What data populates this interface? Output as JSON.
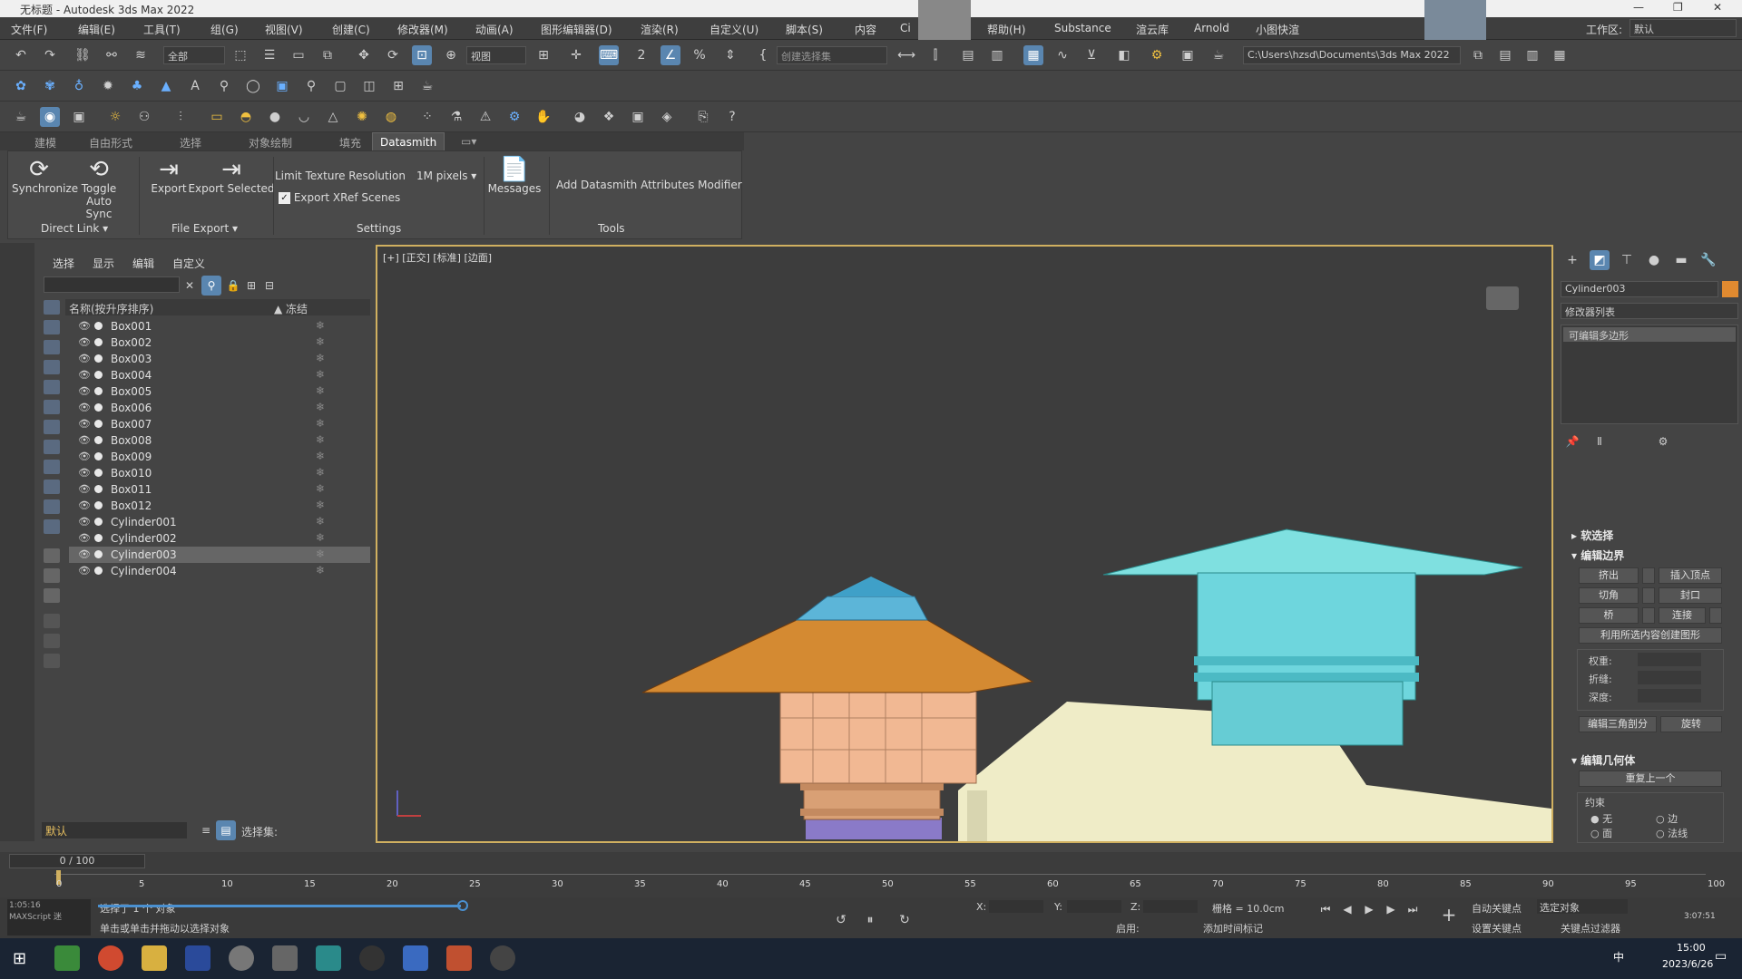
{
  "window": {
    "title": "无标题 - Autodesk 3ds Max 2022"
  },
  "menu": [
    "文件(F)",
    "编辑(E)",
    "工具(T)",
    "组(G)",
    "视图(V)",
    "创建(C)",
    "修改器(M)",
    "动画(A)",
    "图形编辑器(D)",
    "渲染(R)",
    "自定义(U)",
    "脚本(S)",
    "内容",
    "Ci",
    "帮助(H)",
    "Substance",
    "渲云库",
    "Arnold",
    "小图快渲"
  ],
  "workspace": {
    "label": "工作区:",
    "value": "默认"
  },
  "toolbar": {
    "filter_value": "全部",
    "view_value": "视图",
    "selection_set_placeholder": "创建选择集",
    "path_value": "C:\\Users\\hzsd\\Documents\\3ds Max 2022"
  },
  "ribbon_tabs": [
    "建模",
    "自由形式",
    "选择",
    "对象绘制",
    "填充",
    "Datasmith"
  ],
  "ribbon": {
    "synchronize": "Synchronize",
    "toggle": "Toggle",
    "auto_sync": "Auto Sync",
    "export": "Export",
    "export_selected": "Export Selected",
    "limit_texture": "Limit Texture Resolution",
    "pixels": "1M pixels",
    "export_xref": "Export XRef Scenes",
    "messages": "Messages",
    "add_attributes": "Add Datasmith Attributes Modifier",
    "group_direct_link": "Direct Link",
    "group_file_export": "File Export",
    "group_settings": "Settings",
    "group_tools": "Tools"
  },
  "explorer": {
    "tabs": [
      "选择",
      "显示",
      "编辑",
      "自定义"
    ],
    "col_name": "名称(按升序排序)",
    "col_freeze": "▲ 冻结",
    "items": [
      {
        "name": "Box001"
      },
      {
        "name": "Box002"
      },
      {
        "name": "Box003"
      },
      {
        "name": "Box004"
      },
      {
        "name": "Box005"
      },
      {
        "name": "Box006"
      },
      {
        "name": "Box007"
      },
      {
        "name": "Box008"
      },
      {
        "name": "Box009"
      },
      {
        "name": "Box010"
      },
      {
        "name": "Box011"
      },
      {
        "name": "Box012"
      },
      {
        "name": "Cylinder001"
      },
      {
        "name": "Cylinder002"
      },
      {
        "name": "Cylinder003",
        "selected": true
      },
      {
        "name": "Cylinder004"
      }
    ],
    "layer": "默认",
    "selection_set": "选择集:"
  },
  "viewport": {
    "label": "[+] [正交] [标准] [边面]"
  },
  "command_panel": {
    "object_name": "Cylinder003",
    "object_color": "#e08a30",
    "modifier_list": "修改器列表",
    "stack_item": "可编辑多边形",
    "sections": {
      "soft_select": "软选择",
      "edit_borders": "编辑边界",
      "edit_geometry": "编辑几何体"
    },
    "buttons": {
      "extrude": "挤出",
      "insert_vertex": "插入顶点",
      "chamfer": "切角",
      "cap": "封口",
      "bridge": "桥",
      "connect": "连接",
      "create_shape": "利用所选内容创建图形",
      "weight": "权重:",
      "crease": "折缝:",
      "depth": "深度:",
      "edit_tri": "编辑三角剖分",
      "rotate": "旋转",
      "repeat_last": "重复上一个",
      "constraints": "约束",
      "none": "无",
      "edge": "边",
      "face": "面",
      "normal": "法线"
    }
  },
  "timeline": {
    "frame": "0 / 100",
    "ticks": [
      "0",
      "5",
      "10",
      "15",
      "20",
      "25",
      "30",
      "35",
      "40",
      "45",
      "50",
      "55",
      "60",
      "65",
      "70",
      "75",
      "80",
      "85",
      "90",
      "95",
      "100"
    ]
  },
  "status": {
    "selected": "选择了 1 个 对象",
    "hint": "单击或单击并拖动以选择对象",
    "grid": "栅格 = 10.0cm",
    "auto_key": "自动关键点",
    "set_key": "设置关键点",
    "selected_obj": "选定对象",
    "key_filters": "关键点过滤器",
    "add_time_tag": "添加时间标记",
    "enabled": "启用:",
    "x": "X:",
    "y": "Y:",
    "z": "Z:",
    "maxscript": "MAXScript 迷",
    "time_left": "1:05:16",
    "time_right": "3:07:51"
  },
  "taskbar": {
    "time": "15:00",
    "date": "2023/6/26",
    "lang": "中"
  }
}
